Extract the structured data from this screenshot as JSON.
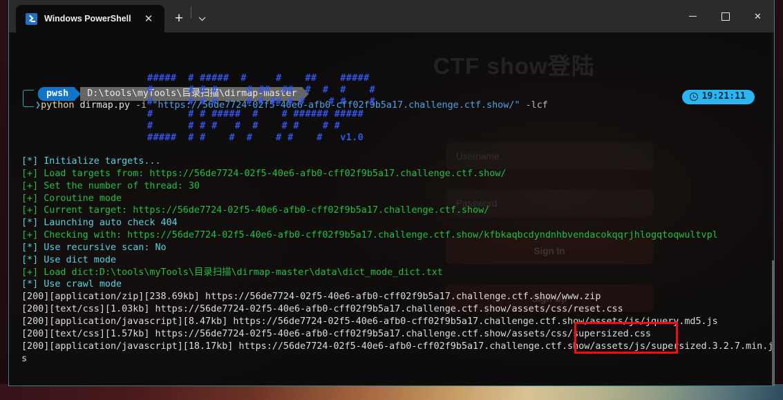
{
  "window": {
    "tab": {
      "title": "Windows PowerShell",
      "icon": "powershell-icon",
      "close_label": "✕"
    },
    "new_tab_label": "+",
    "dropdown_label": "⌵",
    "controls": {
      "minimize": "–",
      "maximize": "□",
      "close": "✕"
    }
  },
  "prompt": {
    "segment_shell": "pwsh",
    "segment_path": "D:\\tools\\myTools\\目录扫描\\dirmap-master",
    "chevron": "❯",
    "command_app": "python",
    "command_script": " dirmap.py ",
    "command_flag_i": "-i",
    "command_target": " \"https://56de7724-02f5-40e6-afb0-cff02f9b5a17.challenge.ctf.show/\"",
    "command_flag_lcf": " -lcf",
    "clock": "19:21:11"
  },
  "banner": {
    "art": "#####  # #####  #     #    ##    #####\n#      # # #     # ##  ##  #  #  #    #\n#      # # #     # # ## # #    # #    #\n#      # # #####  #    # ###### #####\n#      # # #   #  #    # #    # #\n#####  # #    #  #    # #    #   v1.0",
    "version": "v1.0"
  },
  "log": {
    "lines": [
      {
        "type": "info",
        "text": "[*] Initialize targets..."
      },
      {
        "type": "ok",
        "text": "[+] Load targets from: https://56de7724-02f5-40e6-afb0-cff02f9b5a17.challenge.ctf.show/"
      },
      {
        "type": "ok",
        "text": "[+] Set the number of thread: 30"
      },
      {
        "type": "ok",
        "text": "[+] Coroutine mode"
      },
      {
        "type": "ok",
        "text": "[+] Current target: https://56de7724-02f5-40e6-afb0-cff02f9b5a17.challenge.ctf.show/"
      },
      {
        "type": "info",
        "text": "[*] Launching auto check 404"
      },
      {
        "type": "ok",
        "text": "[+] Checking with: https://56de7724-02f5-40e6-afb0-cff02f9b5a17.challenge.ctf.show/kfbkaqbcdyndnhbvendacokqqrjhlogqtoqwultvpl"
      },
      {
        "type": "info",
        "text": "[*] Use recursive scan: No"
      },
      {
        "type": "info",
        "text": "[*] Use dict mode"
      },
      {
        "type": "ok",
        "text": "[+] Load dict:D:\\tools\\myTools\\目录扫描\\dirmap-master\\data\\dict_mode_dict.txt"
      },
      {
        "type": "info",
        "text": "[*] Use crawl mode"
      },
      {
        "type": "res",
        "text": "[200][application/zip][238.69kb] https://56de7724-02f5-40e6-afb0-cff02f9b5a17.challenge.ctf.show/www.zip"
      },
      {
        "type": "res",
        "text": "[200][text/css][1.03kb] https://56de7724-02f5-40e6-afb0-cff02f9b5a17.challenge.ctf.show/assets/css/reset.css"
      },
      {
        "type": "res",
        "text": "[200][application/javascript][8.47kb] https://56de7724-02f5-40e6-afb0-cff02f9b5a17.challenge.ctf.show/assets/js/jquery.md5.js"
      },
      {
        "type": "res",
        "text": "[200][text/css][1.57kb] https://56de7724-02f5-40e6-afb0-cff02f9b5a17.challenge.ctf.show/assets/css/supersized.css"
      },
      {
        "type": "res",
        "text": "[200][application/javascript][18.17kb] https://56de7724-02f5-40e6-afb0-cff02f9b5a17.challenge.ctf.show/assets/js/supersized.3.2.7.min.js"
      }
    ]
  },
  "watermark": {
    "heading": "CTF show登陆",
    "username_placeholder": "Username",
    "password_placeholder": "Password",
    "sign_in_label": "Sign In",
    "sign_up_label": "Sign Up"
  },
  "annotation": {
    "highlighted_text": ".show/www.zip",
    "color": "#f50d0d"
  },
  "colors": {
    "accent_blue": "#1274c8",
    "clock_badge": "#29b6f2",
    "success_green": "#22c043",
    "info_cyan": "#4fd6e0",
    "banner_blue": "#3355ee",
    "window_border": "#3c7f86"
  }
}
